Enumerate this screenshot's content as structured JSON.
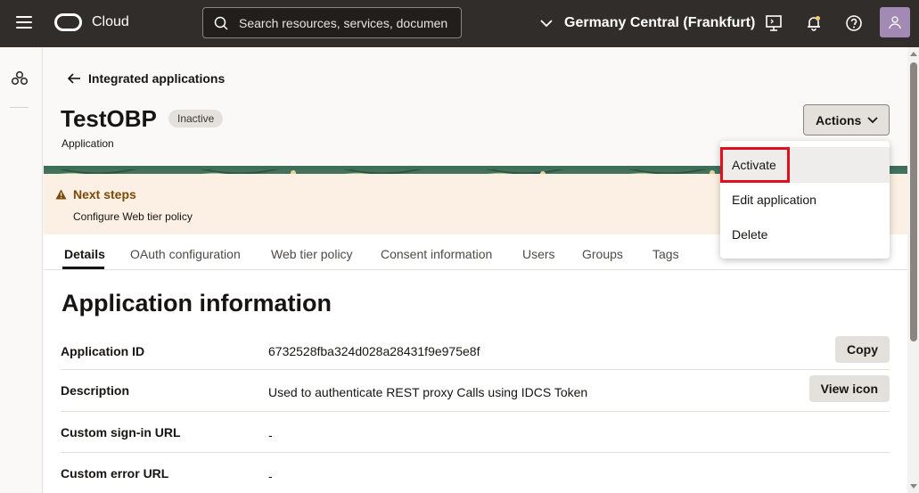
{
  "header": {
    "brand": "Cloud",
    "search_placeholder": "Search resources, services, documen",
    "region": "Germany Central (Frankfurt)"
  },
  "breadcrumb": {
    "back_label": "Integrated applications"
  },
  "page": {
    "title": "TestOBP",
    "status": "Inactive",
    "subtitle": "Application",
    "actions_label": "Actions"
  },
  "actions_menu": {
    "items": [
      "Activate",
      "Edit application",
      "Delete"
    ],
    "highlighted": "Activate"
  },
  "next_steps": {
    "title": "Next steps",
    "text": "Configure Web tier policy"
  },
  "tabs": [
    "Details",
    "OAuth configuration",
    "Web tier policy",
    "Consent information",
    "Users",
    "Groups",
    "Tags"
  ],
  "active_tab": "Details",
  "section": {
    "title": "Application information",
    "rows": [
      {
        "label": "Application ID",
        "value": "6732528fba324d028a28431f9e975e8f",
        "button": "Copy"
      },
      {
        "label": "Description",
        "value": "Used to authenticate REST proxy Calls using IDCS Token",
        "button": "View icon"
      },
      {
        "label": "Custom sign-in URL",
        "value": "-"
      },
      {
        "label": "Custom error URL",
        "value": "-"
      }
    ]
  },
  "icons": {
    "menu": "hamburger-icon",
    "search": "search-icon",
    "region": "chevron-down-icon",
    "cloud_shell": "cloud-shell-icon",
    "notifications": "bell-icon",
    "help": "help-icon",
    "profile": "user-icon",
    "rail": "resources-icon",
    "back": "arrow-left-icon",
    "warning": "warning-icon"
  },
  "colors": {
    "header_bg": "#312d2a",
    "next_steps_bg": "#fbf0e3",
    "highlight_outline": "#e0101e",
    "avatar_bg": "#a28ab4"
  }
}
